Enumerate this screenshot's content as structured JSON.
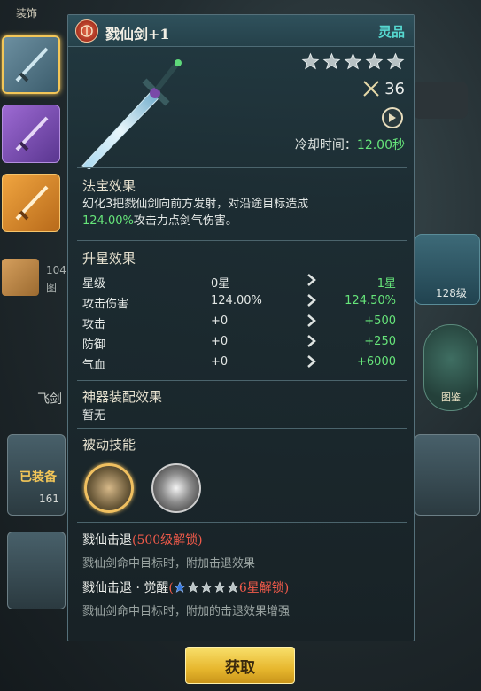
{
  "background": {
    "top_label": "装饰",
    "scroll_text_1": "104",
    "scroll_text_2": "图",
    "feijian_label": "飞剑",
    "equipped_label": "已装备",
    "card_number": "161",
    "char_level": "128级",
    "tujian_label": "图鉴"
  },
  "item": {
    "name": "戮仙剑+1",
    "grade": "灵品",
    "star_count": 5,
    "power": "36",
    "cooldown_label": "冷却时间：",
    "cooldown_value": "12.00秒"
  },
  "fabao": {
    "title": "法宝效果",
    "desc_pre": "幻化3把戮仙剑向前方发射，对沿途目标造成",
    "desc_hl": "124.00%",
    "desc_post": "攻击力点剑气伤害。"
  },
  "upgrade": {
    "title": "升星效果",
    "rows": [
      {
        "label": "星级",
        "current": "0星",
        "next": "1星"
      },
      {
        "label": "攻击伤害",
        "current": "124.00%",
        "next": "124.50%"
      },
      {
        "label": "攻击",
        "current": "+0",
        "next": "+500"
      },
      {
        "label": "防御",
        "current": "+0",
        "next": "+250"
      },
      {
        "label": "气血",
        "current": "+0",
        "next": "+6000"
      }
    ]
  },
  "artifact": {
    "title": "神器装配效果",
    "value": "暂无"
  },
  "passive": {
    "title": "被动技能",
    "skill1_name": "戮仙击退",
    "skill1_lock": "(500级解锁)",
    "skill1_desc": "戮仙剑命中目标时，附加击退效果",
    "skill2_name": "戮仙击退 · 觉醒",
    "skill2_lock_pre": "(",
    "skill2_lock_post": "6星解锁)",
    "skill2_desc": "戮仙剑命中目标时，附加的击退效果增强"
  },
  "buttons": {
    "get": "获取"
  },
  "colors": {
    "accent_green": "#66e57a",
    "grade_cyan": "#56d8d0",
    "lock_red": "#f05a4a",
    "button_gold": "#e7b72e"
  }
}
